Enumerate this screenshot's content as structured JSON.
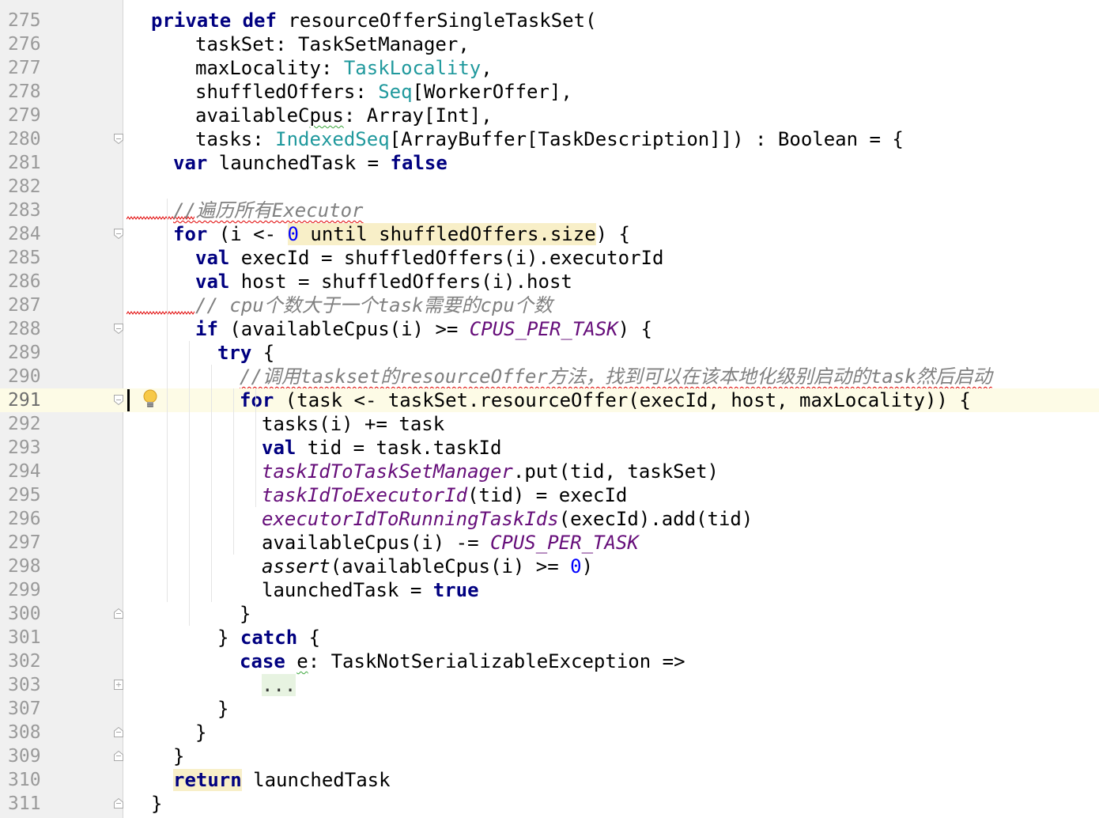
{
  "editor": {
    "language": "Scala",
    "current_line": "291",
    "lines": [
      {
        "ln": "275",
        "indent": 0,
        "fold": "none",
        "tokens": [
          {
            "t": "private def",
            "c": "kw"
          },
          {
            "t": " resourceOfferSingleTaskSet("
          }
        ]
      },
      {
        "ln": "276",
        "indent": 2,
        "fold": "none",
        "tokens": [
          {
            "t": "taskSet: TaskSetManager,"
          }
        ]
      },
      {
        "ln": "277",
        "indent": 2,
        "fold": "none",
        "tokens": [
          {
            "t": "maxLocality: "
          },
          {
            "t": "TaskLocality",
            "c": "typ"
          },
          {
            "t": ","
          }
        ]
      },
      {
        "ln": "278",
        "indent": 2,
        "fold": "none",
        "tokens": [
          {
            "t": "shuffledOffers: "
          },
          {
            "t": "Seq",
            "c": "typ"
          },
          {
            "t": "[WorkerOffer],"
          }
        ]
      },
      {
        "ln": "279",
        "indent": 2,
        "fold": "none",
        "tokens": [
          {
            "t": "availableC"
          },
          {
            "t": "pus",
            "c": "squig-g"
          },
          {
            "t": ": Array[Int],"
          }
        ]
      },
      {
        "ln": "280",
        "indent": 2,
        "fold": "open",
        "tokens": [
          {
            "t": "tasks: "
          },
          {
            "t": "IndexedSeq",
            "c": "typ"
          },
          {
            "t": "[ArrayBuffer[TaskDescription]]) : Boolean = {"
          }
        ]
      },
      {
        "ln": "281",
        "indent": 1,
        "fold": "none",
        "tokens": [
          {
            "t": "var",
            "c": "kw"
          },
          {
            "t": " launchedTask = "
          },
          {
            "t": "false",
            "c": "kw"
          }
        ]
      },
      {
        "ln": "282",
        "indent": 0,
        "fold": "none",
        "tokens": []
      },
      {
        "ln": "283",
        "indent": 1,
        "fold": "none",
        "err": true,
        "tokens": [
          {
            "t": "//遍历所有Executor",
            "c": "cmt squig"
          }
        ]
      },
      {
        "ln": "284",
        "indent": 1,
        "fold": "open",
        "tokens": [
          {
            "t": "for",
            "c": "kw"
          },
          {
            "t": " (i <- "
          },
          {
            "t": "0",
            "c": "num hl"
          },
          {
            "t": " until shuffledOffers.size",
            "c": "hl"
          },
          {
            "t": ") {"
          }
        ]
      },
      {
        "ln": "285",
        "indent": 2,
        "fold": "none",
        "tokens": [
          {
            "t": "val",
            "c": "kw"
          },
          {
            "t": " execId = shuffledOffers(i).executorId"
          }
        ]
      },
      {
        "ln": "286",
        "indent": 2,
        "fold": "none",
        "tokens": [
          {
            "t": "val",
            "c": "kw"
          },
          {
            "t": " host = shuffledOffers(i).host"
          }
        ]
      },
      {
        "ln": "287",
        "indent": 2,
        "fold": "none",
        "err": true,
        "tokens": [
          {
            "t": "// cpu个数大于一个task需要的cpu个数",
            "c": "cmt"
          }
        ]
      },
      {
        "ln": "288",
        "indent": 2,
        "fold": "open",
        "tokens": [
          {
            "t": "if",
            "c": "kw"
          },
          {
            "t": " (availableCpus(i) >= "
          },
          {
            "t": "CPUS_PER_TASK",
            "c": "cnst"
          },
          {
            "t": ") {"
          }
        ]
      },
      {
        "ln": "289",
        "indent": 3,
        "fold": "none",
        "tokens": [
          {
            "t": "try",
            "c": "kw"
          },
          {
            "t": " {"
          }
        ]
      },
      {
        "ln": "290",
        "indent": 4,
        "fold": "none",
        "tokens": [
          {
            "t": "//调用taskset的resourceOffer方法，找到可以在该本地化级别启动的task然后启动",
            "c": "cmt squig"
          }
        ]
      },
      {
        "ln": "291",
        "indent": 4,
        "fold": "open",
        "current": true,
        "tokens": [
          {
            "t": "for",
            "c": "kw"
          },
          {
            "t": " (task <- taskSet.resourceOffer(execId, host, maxLocality)) {"
          }
        ]
      },
      {
        "ln": "292",
        "indent": 5,
        "fold": "none",
        "tokens": [
          {
            "t": "tasks(i) += task"
          }
        ]
      },
      {
        "ln": "293",
        "indent": 5,
        "fold": "none",
        "tokens": [
          {
            "t": "val",
            "c": "kw"
          },
          {
            "t": " tid = task.taskId"
          }
        ]
      },
      {
        "ln": "294",
        "indent": 5,
        "fold": "none",
        "tokens": [
          {
            "t": "taskIdToTaskSetManager",
            "c": "fld"
          },
          {
            "t": ".put(tid, taskSet)"
          }
        ]
      },
      {
        "ln": "295",
        "indent": 5,
        "fold": "none",
        "tokens": [
          {
            "t": "taskIdToExecutorId",
            "c": "fld"
          },
          {
            "t": "(tid) = execId"
          }
        ]
      },
      {
        "ln": "296",
        "indent": 5,
        "fold": "none",
        "tokens": [
          {
            "t": "executorIdToRunningTaskIds",
            "c": "fld"
          },
          {
            "t": "(execId).add(tid)"
          }
        ]
      },
      {
        "ln": "297",
        "indent": 5,
        "fold": "none",
        "tokens": [
          {
            "t": "availableCpus(i) -= "
          },
          {
            "t": "CPUS_PER_TASK",
            "c": "cnst"
          }
        ]
      },
      {
        "ln": "298",
        "indent": 5,
        "fold": "none",
        "tokens": [
          {
            "t": "assert",
            "c": "it"
          },
          {
            "t": "(availableCpus(i) >= "
          },
          {
            "t": "0",
            "c": "num"
          },
          {
            "t": ")"
          }
        ]
      },
      {
        "ln": "299",
        "indent": 5,
        "fold": "none",
        "tokens": [
          {
            "t": "launchedTask = "
          },
          {
            "t": "true",
            "c": "kw"
          }
        ]
      },
      {
        "ln": "300",
        "indent": 4,
        "fold": "close",
        "tokens": [
          {
            "t": "}"
          }
        ]
      },
      {
        "ln": "301",
        "indent": 3,
        "fold": "none",
        "tokens": [
          {
            "t": "} "
          },
          {
            "t": "catch",
            "c": "kw"
          },
          {
            "t": " {"
          }
        ]
      },
      {
        "ln": "302",
        "indent": 4,
        "fold": "none",
        "tokens": [
          {
            "t": "case",
            "c": "kw"
          },
          {
            "t": " "
          },
          {
            "t": "e",
            "c": "squig-g"
          },
          {
            "t": ": TaskNotSerializableException =>"
          }
        ]
      },
      {
        "ln": "303",
        "indent": 5,
        "fold": "plus",
        "tokens": [
          {
            "t": "...",
            "c": "ellipsis"
          }
        ]
      },
      {
        "ln": "307",
        "indent": 3,
        "fold": "none",
        "tokens": [
          {
            "t": "}"
          }
        ]
      },
      {
        "ln": "308",
        "indent": 2,
        "fold": "close",
        "tokens": [
          {
            "t": "}"
          }
        ]
      },
      {
        "ln": "309",
        "indent": 1,
        "fold": "close",
        "tokens": [
          {
            "t": "}"
          }
        ]
      },
      {
        "ln": "310",
        "indent": 1,
        "fold": "none",
        "tokens": [
          {
            "t": "return",
            "c": "kw hl"
          },
          {
            "t": " launchedTask"
          }
        ]
      },
      {
        "ln": "311",
        "indent": 0,
        "fold": "close",
        "tokens": [
          {
            "t": "}"
          }
        ]
      }
    ]
  },
  "icons": {
    "intention": "lightbulb-icon",
    "fold_open": "fold-open-icon",
    "fold_close": "fold-close-icon",
    "fold_expand": "fold-expand-icon"
  },
  "colors": {
    "keyword": "#000080",
    "type": "#20999d",
    "number": "#0000ff",
    "field": "#660e7a",
    "comment": "#808080",
    "error_squiggle": "#e00000",
    "current_line": "#fdfbe6"
  }
}
